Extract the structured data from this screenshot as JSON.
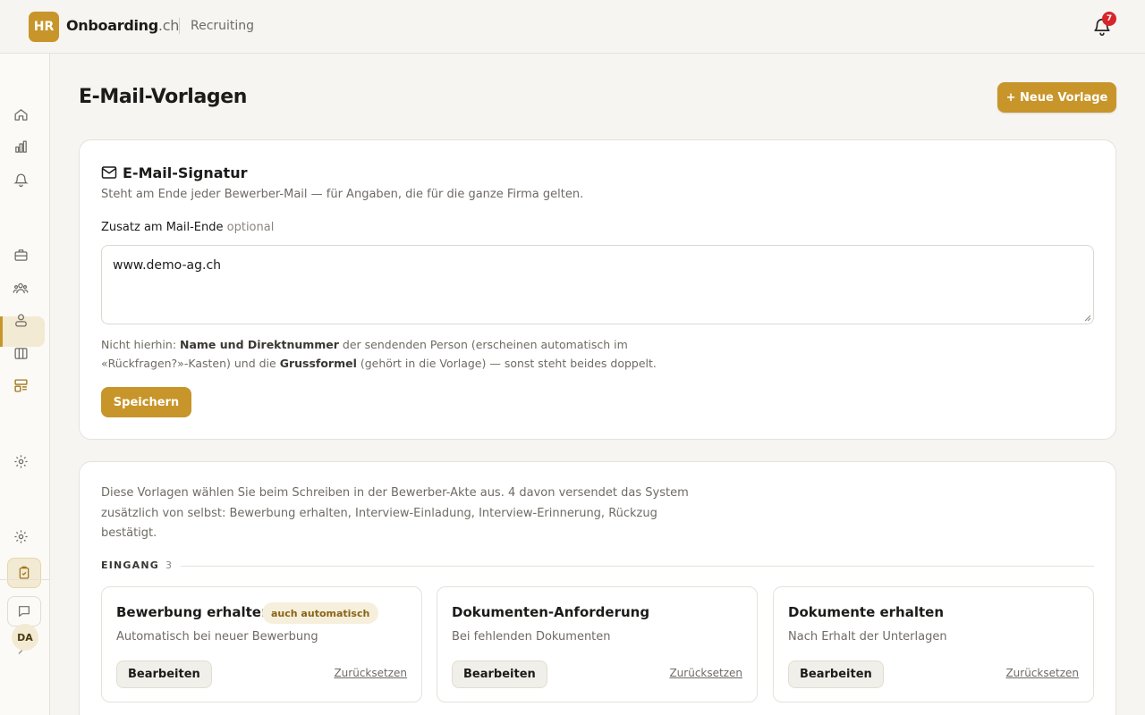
{
  "brand": {
    "badge": "HR",
    "name": "Onboarding",
    "suffix": ".ch",
    "section": "Recruiting"
  },
  "notifications": {
    "count": "7"
  },
  "sidebar": {
    "items": [
      "home-icon",
      "chart-icon",
      "bell-icon",
      "briefcase-icon",
      "group-icon",
      "users-icon",
      "board-icon",
      "templates-icon",
      "settings-icon"
    ],
    "active": "templates-icon",
    "bottom": [
      "settings-icon",
      "checklist-icon",
      "chat-icon",
      "chevron-right-icon"
    ],
    "avatar": "DA"
  },
  "page": {
    "title": "E-Mail-Vorlagen",
    "new_button": "+ Neue Vorlage"
  },
  "signature": {
    "title": "E-Mail-Signatur",
    "description": "Steht am Ende jeder Bewerber-Mail — für Angaben, die für die ganze Firma gelten.",
    "field_label": "Zusatz am Mail-Ende",
    "field_optional": "optional",
    "value": "www.demo-ag.ch",
    "hint_1": "Nicht hierhin: ",
    "hint_b1": "Name und Direktnummer",
    "hint_2": " der sendenden Person (erscheinen automatisch im «Rückfragen?»-Kasten) und die ",
    "hint_b2": "Grussformel",
    "hint_3": " (gehört in die Vorlage) — sonst steht beides doppelt.",
    "save": "Speichern"
  },
  "templates": {
    "description": "Diese Vorlagen wählen Sie beim Schreiben in der Bewerber-Akte aus. 4 davon versendet das System zusätzlich von selbst: Bewerbung erhalten, Interview-Einladung, Interview-Erinnerung, Rückzug bestätigt.",
    "group": {
      "label": "EINGANG",
      "count": "3"
    },
    "cards": [
      {
        "title": "Bewerbung erhalten",
        "badge": "auch automatisch",
        "subtitle": "Automatisch bei neuer Bewerbung",
        "edit": "Bearbeiten",
        "reset": "Zurücksetzen"
      },
      {
        "title": "Dokumenten-Anforderung",
        "subtitle": "Bei fehlenden Dokumenten",
        "edit": "Bearbeiten",
        "reset": "Zurücksetzen"
      },
      {
        "title": "Dokumente erhalten",
        "subtitle": "Nach Erhalt der Unterlagen",
        "edit": "Bearbeiten",
        "reset": "Zurücksetzen"
      }
    ]
  },
  "colors": {
    "accent": "#c8952a",
    "badge_red": "#d7262a",
    "background": "#f7f5f1"
  }
}
